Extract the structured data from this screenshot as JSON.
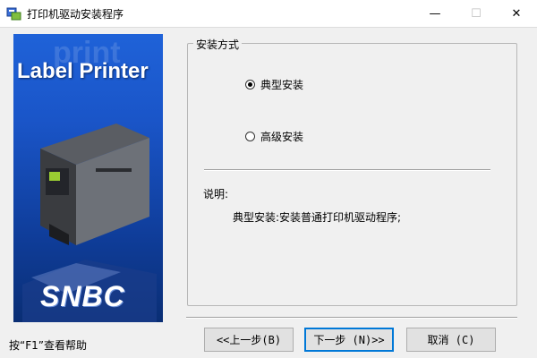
{
  "window": {
    "title": "打印机驱动安装程序"
  },
  "window_controls": {
    "minimize": "—",
    "maximize": "☐",
    "close": "✕"
  },
  "side_panel": {
    "brand_text": "Label Printer",
    "ghost_text": "print",
    "logo_text": "SNBC"
  },
  "install_group": {
    "legend": "安装方式",
    "options": [
      {
        "label": "典型安装",
        "selected": true
      },
      {
        "label": "高级安装",
        "selected": false
      }
    ]
  },
  "description": {
    "title": "说明:",
    "body": "典型安装:安装普通打印机驱动程序;"
  },
  "footer": {
    "help_hint": "按“F1”查看帮助",
    "back_label": "<<上一步(B)",
    "next_label": "下一步 (N)>>",
    "cancel_label": "取消 (C)"
  },
  "colors": {
    "focus_border": "#0078d7",
    "panel_blue": "#1f62d8"
  }
}
